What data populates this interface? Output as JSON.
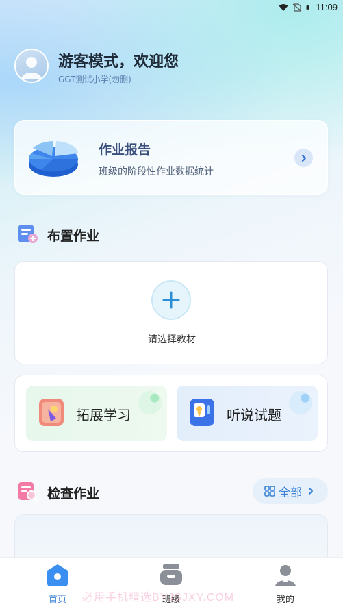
{
  "status_bar": {
    "time": "11:09"
  },
  "header": {
    "greeting": "游客模式，欢迎您",
    "school": "GGT测试小学(勿删)"
  },
  "report": {
    "title": "作业报告",
    "subtitle": "班级的阶段性作业数据统计"
  },
  "assign": {
    "section_title": "布置作业",
    "select_label": "请选择教材"
  },
  "practice": {
    "tiles": [
      {
        "label": "拓展学习"
      },
      {
        "label": "听说试题"
      }
    ]
  },
  "check": {
    "section_title": "检查作业",
    "all_label": "全部"
  },
  "nav": {
    "items": [
      {
        "label": "首页",
        "active": true
      },
      {
        "label": "班级",
        "active": false
      },
      {
        "label": "我的",
        "active": false
      }
    ]
  },
  "watermark": "必用手机精选BYJSJXY.COM",
  "colors": {
    "accent": "#3a83d6",
    "report_title": "#3a4f7c",
    "tile_green_bg": "#e7f7ec",
    "tile_blue_bg": "#e3eefb"
  }
}
